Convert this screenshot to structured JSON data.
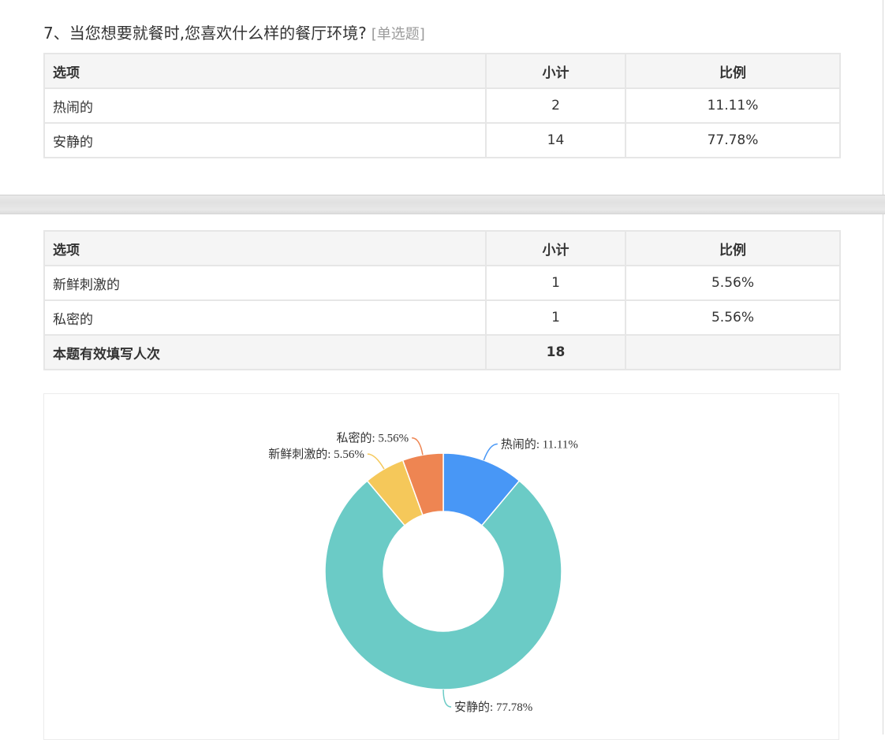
{
  "question": {
    "title": "7、当您想要就餐时,您喜欢什么样的餐厅环境?",
    "type_label": "[单选题]"
  },
  "table": {
    "headers": {
      "option": "选项",
      "count": "小计",
      "percent": "比例"
    },
    "rows_top": [
      {
        "option": "热闹的",
        "count": "2",
        "percent": "11.11%"
      },
      {
        "option": "安静的",
        "count": "14",
        "percent": "77.78%"
      }
    ],
    "rows_bottom": [
      {
        "option": "新鲜刺激的",
        "count": "1",
        "percent": "5.56%"
      },
      {
        "option": "私密的",
        "count": "1",
        "percent": "5.56%"
      }
    ],
    "total": {
      "label": "本题有效填写人次",
      "count": "18"
    }
  },
  "chart_data": {
    "type": "pie",
    "donut": true,
    "categories": [
      "热闹的",
      "安静的",
      "新鲜刺激的",
      "私密的"
    ],
    "values": [
      11.11,
      77.78,
      5.56,
      5.56
    ],
    "labels": [
      "热闹的: 11.11%",
      "安静的: 77.78%",
      "新鲜刺激的: 5.56%",
      "私密的: 5.56%"
    ],
    "colors": [
      "#4897f6",
      "#6bcbc6",
      "#f5c85a",
      "#ee8552"
    ],
    "title": "",
    "legend": "none"
  }
}
